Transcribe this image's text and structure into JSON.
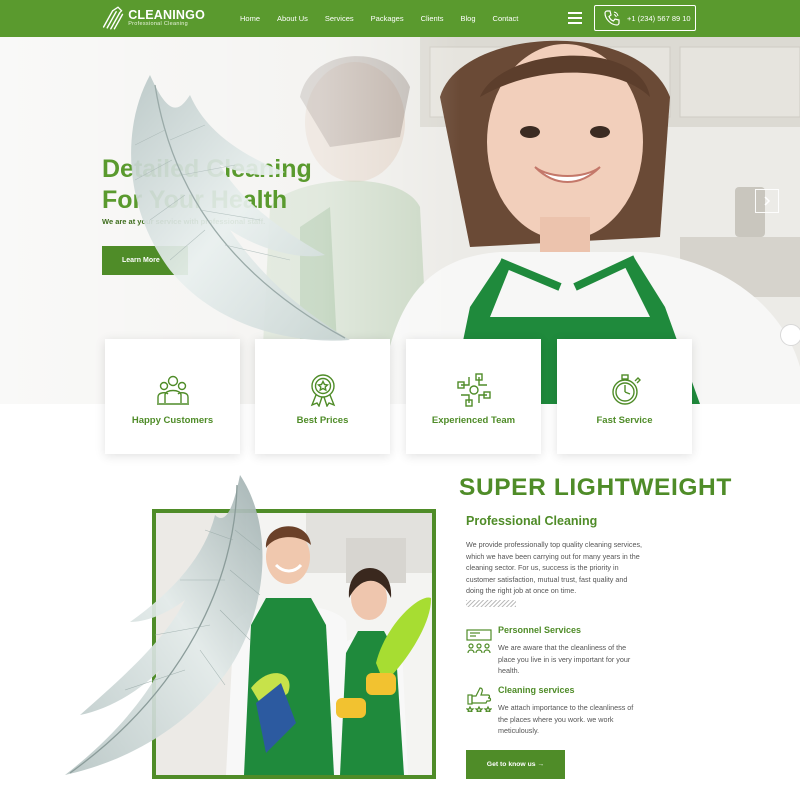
{
  "brand": {
    "name": "CLEANINGO",
    "tagline": "Professional Cleaning"
  },
  "nav": {
    "links": [
      "Home",
      "About Us",
      "Services",
      "Packages",
      "Clients",
      "Blog",
      "Contact"
    ],
    "phone": "+1 (234) 567 89 10",
    "icons": [
      "menu-icon",
      "phone-icon"
    ]
  },
  "hero": {
    "title_line1": "Detailed Cleaning",
    "title_line2": "For Your Health",
    "subtitle": "We are at your service with professional staff.",
    "button": "Learn More"
  },
  "features": [
    {
      "label": "Happy Customers",
      "icon": "customers-icon"
    },
    {
      "label": "Best Prices",
      "icon": "award-badge-icon"
    },
    {
      "label": "Experienced Team",
      "icon": "team-hands-icon"
    },
    {
      "label": "Fast Service",
      "icon": "stopwatch-icon"
    }
  ],
  "about": {
    "heading": "SUPER LIGHTWEIGHT",
    "subtitle": "Professional Cleaning",
    "text": "We provide professionally top quality cleaning services, which we have been carrying out for many years in the cleaning sector. For us, success is the priority in customer satisfaction, mutual trust, fast quality and doing the right job at once on time.",
    "services": [
      {
        "title": "Personnel Services",
        "text": "We are aware that the cleanliness of the place you live in is very important for your health.",
        "icon": "personnel-services-icon"
      },
      {
        "title": "Cleaning services",
        "text": "We attach importance to the cleanliness of the places where you work. we work meticulously.",
        "icon": "thumbs-up-stars-icon"
      }
    ],
    "button": "Get to know us →"
  },
  "colors": {
    "brand_green": "#5a9a2e",
    "dark_green": "#4f8c28",
    "apron_green": "#1f8a3c"
  }
}
